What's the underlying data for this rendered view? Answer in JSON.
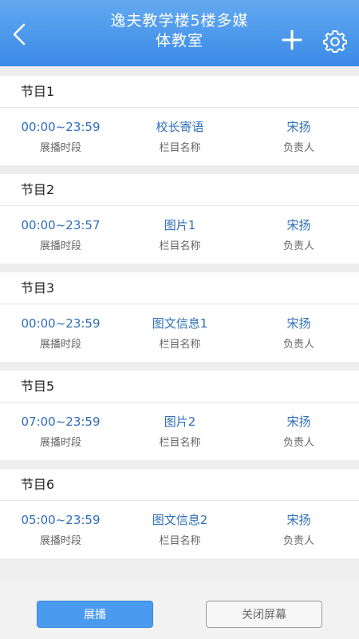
{
  "header": {
    "title_line1": "逸夫教学楼5楼多媒",
    "title_line2": "体教室",
    "back_icon": "chevron-left-icon",
    "add_icon": "plus-icon",
    "settings_icon": "gear-icon",
    "color": "#3a8ae6"
  },
  "programs": [
    {
      "name": "节目1",
      "time": "00:00~23:59",
      "column": "校长寄语",
      "owner": "宋扬"
    },
    {
      "name": "节目2",
      "time": "00:00~23:57",
      "column": "图片1",
      "owner": "宋扬"
    },
    {
      "name": "节目3",
      "time": "00:00~23:59",
      "column": "图文信息1",
      "owner": "宋扬"
    },
    {
      "name": "节目5",
      "time": "07:00~23:59",
      "column": "图片2",
      "owner": "宋扬"
    },
    {
      "name": "节目6",
      "time": "05:00~23:59",
      "column": "图文信息2",
      "owner": "宋扬"
    }
  ],
  "labels": {
    "time": "展播时段",
    "column": "栏目名称",
    "owner": "负责人"
  },
  "buttons": {
    "play": "展播",
    "close_screen": "关闭屏幕"
  },
  "colors": {
    "value_text": "#2f6fb8",
    "primary_button": "#4a9af0"
  }
}
